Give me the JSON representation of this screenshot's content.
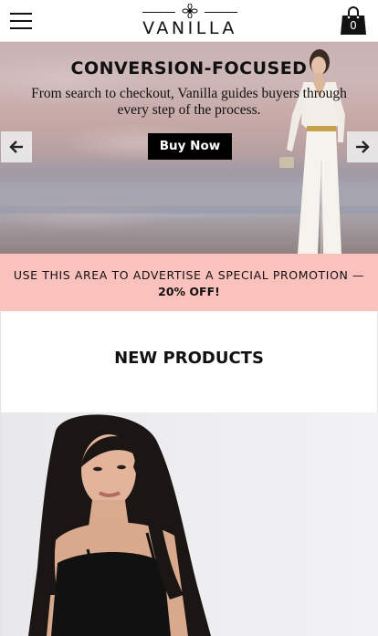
{
  "header": {
    "menu_icon": "hamburger-menu-icon",
    "logo_text": "VANILLA",
    "logo_icon": "flower-emblem-icon",
    "cart_icon": "shopping-bag-icon",
    "cart_count": "0"
  },
  "hero": {
    "title": "CONVERSION-FOCUSED",
    "subtitle": "From search to checkout, Vanilla guides buyers through every step of the process.",
    "button_label": "Buy Now",
    "prev_icon": "arrow-left-icon",
    "next_icon": "arrow-right-icon"
  },
  "promo": {
    "line1": "USE THIS AREA TO ADVERTISE A SPECIAL PROMOTION —",
    "line2": "20% OFF!"
  },
  "section": {
    "title": "NEW PRODUCTS"
  },
  "colors": {
    "promo_bg": "#fbc1bc",
    "button_bg": "#000000",
    "text": "#111111"
  }
}
